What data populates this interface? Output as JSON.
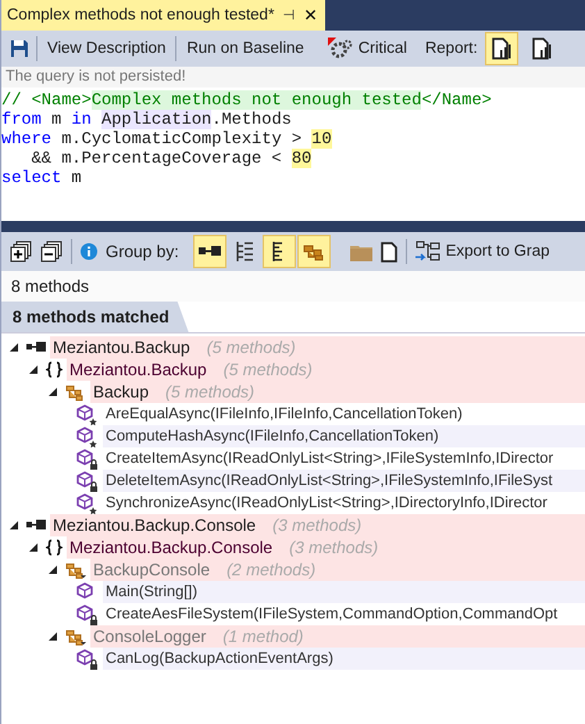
{
  "tab": {
    "title": "Complex methods not enough tested*",
    "pin": "⊣",
    "close": "✕"
  },
  "toolbar": {
    "view_description": "View Description",
    "run_on_baseline": "Run on Baseline",
    "critical": "Critical",
    "report_label": "Report:",
    "report_buttons": [
      {
        "selected": true
      },
      {
        "selected": false
      }
    ]
  },
  "notice": "The query is not persisted!",
  "code": [
    [
      {
        "kind": "comment",
        "text": "// <Name>"
      },
      {
        "kind": "name",
        "text": "Complex methods not enough tested"
      },
      {
        "kind": "comment",
        "text": "</Name>"
      }
    ],
    [
      {
        "kind": "keyword",
        "text": "from"
      },
      {
        "kind": "plain",
        "text": " m "
      },
      {
        "kind": "keyword",
        "text": "in "
      },
      {
        "kind": "ref",
        "text": "Application"
      },
      {
        "kind": "plain",
        "text": ".Methods"
      }
    ],
    [
      {
        "kind": "keyword",
        "text": "where"
      },
      {
        "kind": "plain",
        "text": " m.CyclomaticComplexity > "
      },
      {
        "kind": "number",
        "text": "10"
      }
    ],
    [
      {
        "kind": "plain",
        "text": "   && m.PercentageCoverage < "
      },
      {
        "kind": "number",
        "text": "80"
      }
    ],
    [
      {
        "kind": "keyword",
        "text": "select"
      },
      {
        "kind": "plain",
        "text": " m"
      }
    ]
  ],
  "results_toolbar": {
    "group_by_label": "Group by:",
    "group_by_buttons": [
      {
        "kind": "assembly",
        "selected": true
      },
      {
        "kind": "tree",
        "selected": false
      },
      {
        "kind": "list",
        "selected": true
      },
      {
        "kind": "type",
        "selected": true
      }
    ],
    "export": "Export to Grap"
  },
  "count": "8 methods",
  "header": "8 methods matched",
  "tree": [
    {
      "kind": "assembly",
      "name": "Meziantou.Backup",
      "count": "(5 methods)",
      "expanded": true,
      "children": [
        {
          "kind": "namespace",
          "name": "Meziantou.Backup",
          "count": "(5 methods)",
          "expanded": true,
          "children": [
            {
              "kind": "type",
              "name": "Backup",
              "count": "(5 methods)",
              "expanded": true,
              "dimmed": false,
              "children": [
                {
                  "kind": "method",
                  "name": "AreEqualAsync(IFileInfo,IFileInfo,CancellationToken)",
                  "starred": true,
                  "locked": false
                },
                {
                  "kind": "method",
                  "name": "ComputeHashAsync(IFileInfo,CancellationToken)",
                  "starred": true,
                  "locked": false
                },
                {
                  "kind": "method",
                  "name": "CreateItemAsync(IReadOnlyList<String>,IFileSystemInfo,IDirector",
                  "starred": false,
                  "locked": true
                },
                {
                  "kind": "method",
                  "name": "DeleteItemAsync(IReadOnlyList<String>,IFileSystemInfo,IFileSyst",
                  "starred": false,
                  "locked": true
                },
                {
                  "kind": "method",
                  "name": "SynchronizeAsync(IReadOnlyList<String>,IDirectoryInfo,IDirector",
                  "starred": true,
                  "locked": false
                }
              ]
            }
          ]
        }
      ]
    },
    {
      "kind": "assembly",
      "name": "Meziantou.Backup.Console",
      "count": "(3 methods)",
      "expanded": true,
      "children": [
        {
          "kind": "namespace",
          "name": "Meziantou.Backup.Console",
          "count": "(3 methods)",
          "expanded": true,
          "children": [
            {
              "kind": "type",
              "name": "BackupConsole",
              "count": "(2 methods)",
              "expanded": true,
              "dimmed": true,
              "children": [
                {
                  "kind": "method",
                  "name": "Main(String[])",
                  "starred": false,
                  "locked": false
                },
                {
                  "kind": "method",
                  "name": "CreateAesFileSystem(IFileSystem,CommandOption,CommandOpt",
                  "starred": false,
                  "locked": true
                }
              ]
            },
            {
              "kind": "type",
              "name": "ConsoleLogger",
              "count": "(1 method)",
              "expanded": true,
              "dimmed": true,
              "children": [
                {
                  "kind": "method",
                  "name": "CanLog(BackupActionEventArgs)",
                  "starred": false,
                  "locked": true
                }
              ]
            }
          ]
        }
      ]
    }
  ]
}
